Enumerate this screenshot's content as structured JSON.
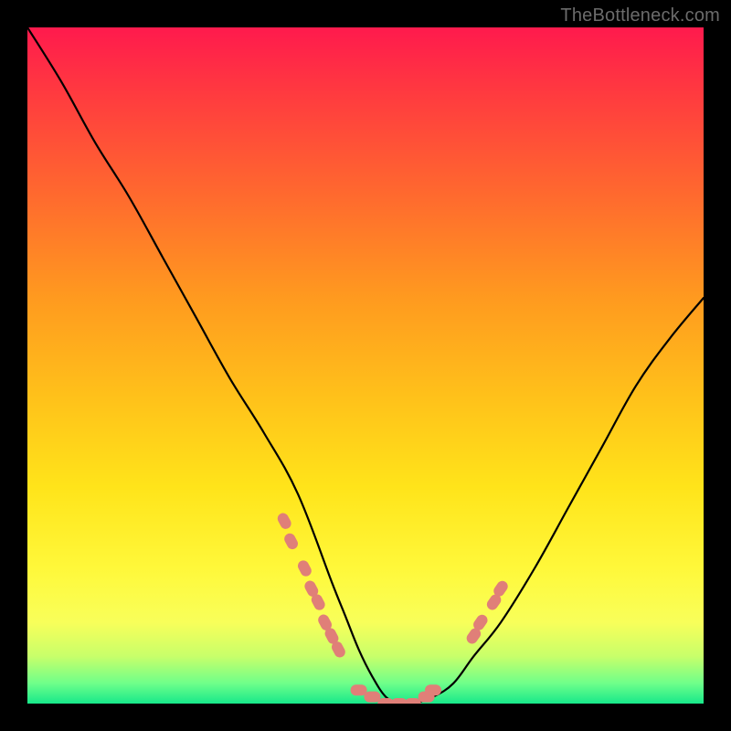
{
  "attribution": "TheBottleneck.com",
  "colors": {
    "frame": "#000000",
    "gradient_top": "#ff1a4d",
    "gradient_bottom": "#17e88a",
    "curve": "#000000",
    "marker": "#e07f78"
  },
  "chart_data": {
    "type": "line",
    "title": "",
    "xlabel": "",
    "ylabel": "",
    "xlim": [
      0,
      100
    ],
    "ylim": [
      0,
      100
    ],
    "grid": false,
    "legend": false,
    "series": [
      {
        "name": "bottleneck-curve",
        "x": [
          0,
          5,
          10,
          15,
          20,
          25,
          30,
          35,
          40,
          45,
          47,
          49,
          51,
          53,
          55,
          57,
          60,
          63,
          66,
          70,
          75,
          80,
          85,
          90,
          95,
          100
        ],
        "y": [
          100,
          92,
          83,
          75,
          66,
          57,
          48,
          40,
          31,
          18,
          13,
          8,
          4,
          1,
          0,
          0,
          1,
          3,
          7,
          12,
          20,
          29,
          38,
          47,
          54,
          60
        ]
      }
    ],
    "markers": [
      {
        "name": "left-cluster",
        "x": 38,
        "y": 27
      },
      {
        "name": "left-cluster",
        "x": 39,
        "y": 24
      },
      {
        "name": "left-cluster",
        "x": 41,
        "y": 20
      },
      {
        "name": "left-cluster",
        "x": 42,
        "y": 17
      },
      {
        "name": "left-cluster",
        "x": 43,
        "y": 15
      },
      {
        "name": "left-cluster",
        "x": 44,
        "y": 12
      },
      {
        "name": "left-cluster",
        "x": 45,
        "y": 10
      },
      {
        "name": "left-cluster",
        "x": 46,
        "y": 8
      },
      {
        "name": "trough",
        "x": 49,
        "y": 2
      },
      {
        "name": "trough",
        "x": 51,
        "y": 1
      },
      {
        "name": "trough",
        "x": 53,
        "y": 0
      },
      {
        "name": "trough",
        "x": 55,
        "y": 0
      },
      {
        "name": "trough",
        "x": 57,
        "y": 0
      },
      {
        "name": "trough",
        "x": 59,
        "y": 1
      },
      {
        "name": "trough",
        "x": 60,
        "y": 2
      },
      {
        "name": "right-cluster",
        "x": 66,
        "y": 10
      },
      {
        "name": "right-cluster",
        "x": 67,
        "y": 12
      },
      {
        "name": "right-cluster",
        "x": 69,
        "y": 15
      },
      {
        "name": "right-cluster",
        "x": 70,
        "y": 17
      }
    ]
  }
}
